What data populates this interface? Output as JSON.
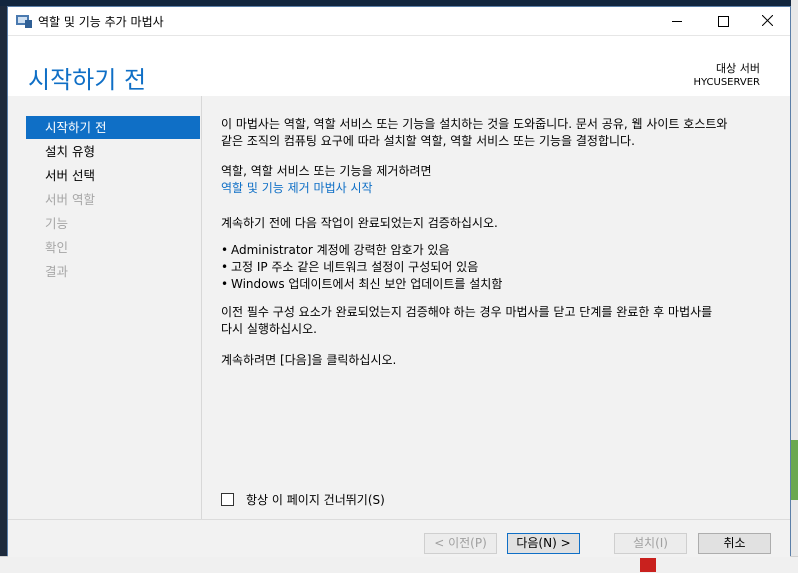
{
  "window": {
    "title": "역할 및 기능 추가 마법사"
  },
  "header": {
    "page_title": "시작하기 전",
    "server_label": "대상 서버",
    "server_name": "HYCUSERVER"
  },
  "nav": {
    "items": [
      {
        "label": "시작하기 전",
        "state": "active"
      },
      {
        "label": "설치 유형",
        "state": "enabled"
      },
      {
        "label": "서버 선택",
        "state": "enabled"
      },
      {
        "label": "서버 역할",
        "state": "disabled"
      },
      {
        "label": "기능",
        "state": "disabled"
      },
      {
        "label": "확인",
        "state": "disabled"
      },
      {
        "label": "결과",
        "state": "disabled"
      }
    ]
  },
  "content": {
    "intro_line1": "이 마법사는 역할, 역할 서비스 또는 기능을 설치하는 것을 도와줍니다. 문서 공유, 웹 사이트 호스트와",
    "intro_line2": "같은 조직의 컴퓨팅 요구에 따라 설치할 역할, 역할 서비스 또는 기능을 결정합니다.",
    "remove_prompt": "역할, 역할 서비스 또는 기능을 제거하려면",
    "remove_link": "역할 및 기능 제거 마법사 시작",
    "verify_text": "계속하기 전에 다음 작업이 완료되었는지 검증하십시오.",
    "bullets": [
      "Administrator 계정에 강력한 암호가 있음",
      "고정 IP 주소 같은 네트워크 설정이 구성되어 있음",
      "Windows 업데이트에서 최신 보안 업데이트를 설치함"
    ],
    "prereq_line1": "이전 필수 구성 요소가 완료되었는지 검증해야 하는 경우 마법사를 닫고 단계를 완료한 후 마법사를",
    "prereq_line2": "다시 실행하십시오.",
    "continue_text": "계속하려면 [다음]을 클릭하십시오."
  },
  "skip_checkbox": {
    "label": "항상 이 페이지 건너뛰기(S)",
    "checked": false
  },
  "footer": {
    "prev_label": "< 이전(P)",
    "next_label": "다음(N) >",
    "install_label": "설치(I)",
    "cancel_label": "취소"
  },
  "colors": {
    "accent": "#0f6fc6",
    "disabled_text": "#a6a6a6"
  }
}
